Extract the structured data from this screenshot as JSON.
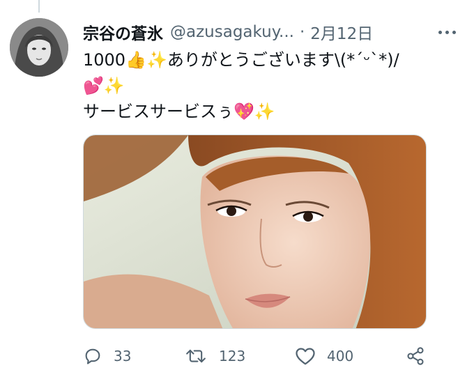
{
  "tweet": {
    "author_name": "宗谷の蒼氷",
    "author_handle": "@azusagakuy...",
    "separator": "·",
    "date": "2月12日",
    "text_line1": "1000👍✨ありがとうございます\\(*´ᵕ`*)/",
    "text_line2": "💕✨",
    "text_line3": "サービスサービスぅ💖✨"
  },
  "actions": {
    "reply_count": "33",
    "retweet_count": "123",
    "like_count": "400"
  },
  "icons": {
    "more": "more-horizontal-icon",
    "reply": "reply-icon",
    "retweet": "retweet-icon",
    "like": "heart-icon",
    "share": "share-icon"
  },
  "colors": {
    "text_primary": "#0f1419",
    "text_secondary": "#536471",
    "border": "#cfd9de"
  }
}
